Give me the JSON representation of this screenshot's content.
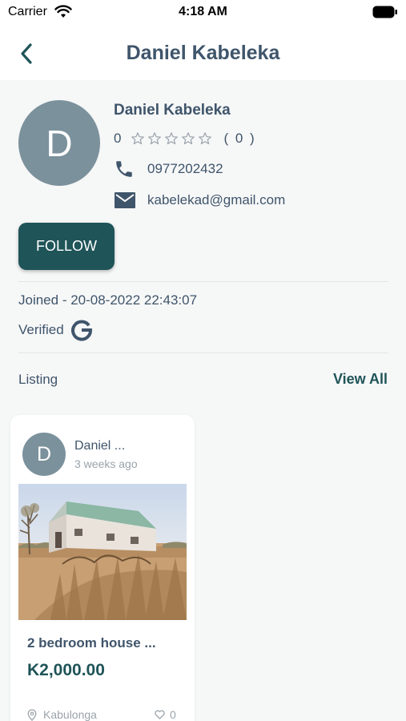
{
  "status_bar": {
    "carrier": "Carrier",
    "time": "4:18 AM"
  },
  "nav": {
    "title": "Daniel Kabeleka",
    "back_icon": "chevron-left-icon"
  },
  "profile": {
    "avatar_letter": "D",
    "name": "Daniel Kabeleka",
    "rating_value": "0",
    "rating_count": "( 0 )",
    "stars_filled": 0,
    "stars_total": 5,
    "phone": "0977202432",
    "email": "kabelekad@gmail.com",
    "follow_label": "FOLLOW",
    "joined": "Joined - 20-08-2022 22:43:07",
    "verified_label": "Verified",
    "verified_icon": "google-icon"
  },
  "listing": {
    "label": "Listing",
    "view_all": "View All",
    "items": [
      {
        "avatar_letter": "D",
        "owner": "Daniel ...",
        "time_ago": "3 weeks ago",
        "title": "2 bedroom house ...",
        "price": "K2,000.00",
        "location": "Kabulonga",
        "likes": "0"
      }
    ]
  },
  "colors": {
    "primary": "#1f5458",
    "text": "#3f556b",
    "avatar": "#7b919c",
    "background": "#f6f7f7",
    "muted": "#9aa3aa"
  }
}
